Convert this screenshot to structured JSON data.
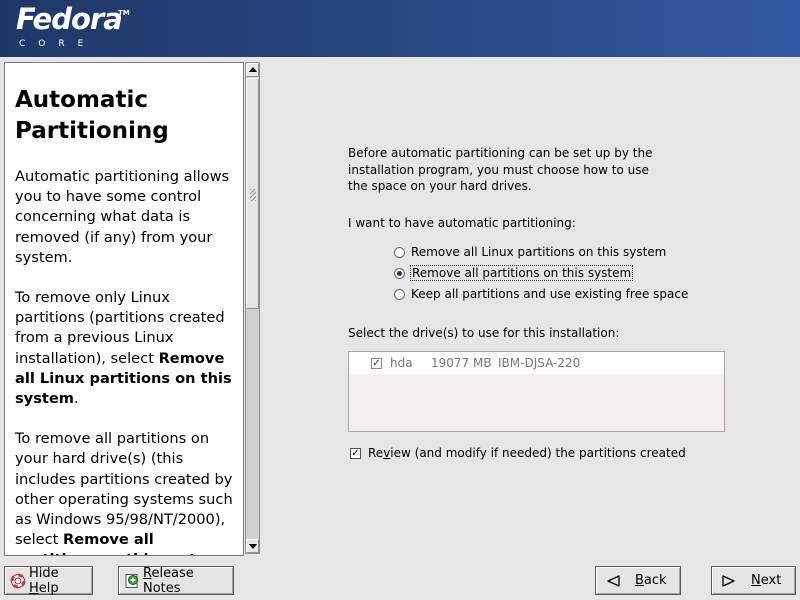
{
  "brand": {
    "logo_text": "Fedora",
    "logo_sub": "CORE",
    "tm": "TM"
  },
  "help": {
    "title": "Automatic Partitioning",
    "para1": "Automatic partitioning allows you to have some control concerning what data is removed (if any) from your system.",
    "para2_text": "To remove only Linux partitions (partitions created from a previous Linux installation), select ",
    "para2_bold": "Remove all Linux partitions on this system",
    "para2_end": ".",
    "para3_text": "To remove all partitions on your hard drive(s) (this includes partitions created by other operating systems such as Windows 95/98/NT/2000), select ",
    "para3_bold": "Remove all partitions on this system",
    "para3_end": "."
  },
  "main": {
    "intro": "Before automatic partitioning can be set up by the installation program, you must choose how to use the space on your hard drives.",
    "want_label": "I want to have automatic partitioning:",
    "options": [
      {
        "label": "Remove all Linux partitions on this system",
        "selected": false
      },
      {
        "label": "Remove all partitions on this system",
        "selected": true
      },
      {
        "label": "Keep all partitions and use existing free space",
        "selected": false
      }
    ],
    "drives_label": "Select the drive(s) to use for this installation:",
    "drives": [
      {
        "name": "hda",
        "size": "19077 MB",
        "model": "IBM-DJSA-220",
        "checked": true
      }
    ],
    "review_pre": "Re",
    "review_u": "v",
    "review_post": "iew (and modify if needed) the partitions created",
    "review_checked": true
  },
  "buttons": {
    "hide_help_pre": "Hide ",
    "hide_help_u": "H",
    "hide_help_post": "elp",
    "release_u": "R",
    "release_post": "elease Notes",
    "back_u": "B",
    "back_post": "ack",
    "next_u": "N",
    "next_post": "ext"
  }
}
